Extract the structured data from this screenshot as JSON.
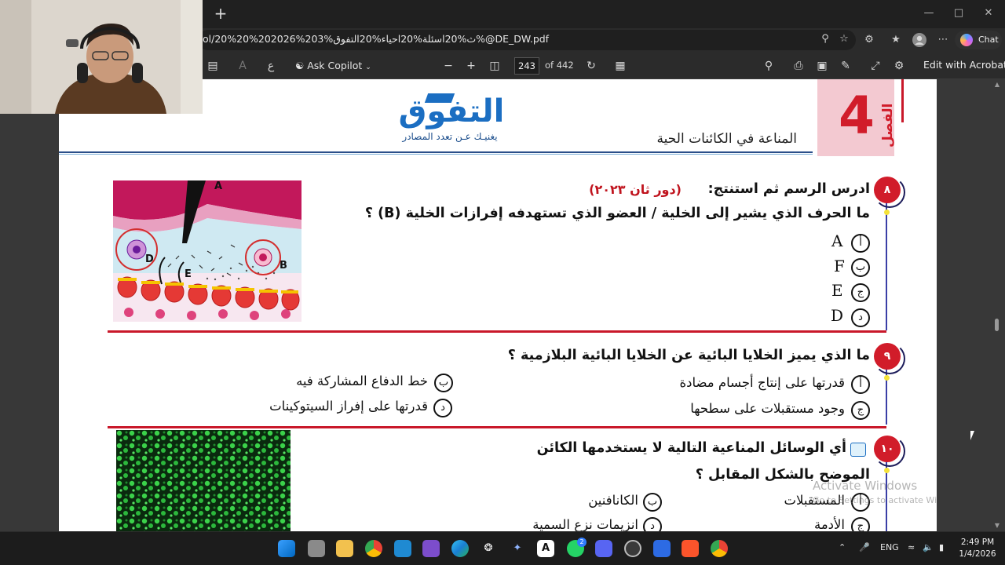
{
  "browser": {
    "url": "ol/20%20%202026%203%ث%20اسئلة%20احياء%20التفوق%@DE_DW.pdf"
  },
  "copilot_chat": {
    "label": "Chat"
  },
  "pdf_toolbar": {
    "ask_copilot": "Ask Copilot",
    "current_page": "243",
    "page_total": "of 442",
    "edit_acrobat": "Edit with Acrobat"
  },
  "page_header": {
    "chapter_label": "الفصل",
    "chapter_number": "4",
    "logo_title": "التفوق",
    "logo_tagline": "يغنيـك عـن تعدد المصادر",
    "subject": "المناعة في الكائنات الحية"
  },
  "questions": [
    {
      "number": "٨",
      "intro": "ادرس الرسم ثم استنتج:",
      "note": "(دور ثان ٢٠٢٣)",
      "text": "ما الحرف الذي يشير إلى الخلية / العضو الذي تستهدفه إفرازات الخلية (B) ؟",
      "options": [
        {
          "letter": "أ",
          "value": "A"
        },
        {
          "letter": "ب",
          "value": "F"
        },
        {
          "letter": "ج",
          "value": "E"
        },
        {
          "letter": "د",
          "value": "D"
        }
      ],
      "figure_labels": [
        "A",
        "B",
        "D",
        "E"
      ]
    },
    {
      "number": "٩",
      "text": "ما الذي يميز الخلايا البائية عن الخلايا البائية البلازمية ؟",
      "options": [
        {
          "letter": "أ",
          "value": "قدرتها على إنتاج أجسام مضادة"
        },
        {
          "letter": "ب",
          "value": "خط الدفاع المشاركة فيه"
        },
        {
          "letter": "ج",
          "value": "وجود مستقبلات على سطحها"
        },
        {
          "letter": "د",
          "value": "قدرتها على إفراز السيتوكينات"
        }
      ]
    },
    {
      "number": "١٠",
      "text": "أي الوسائل المناعية التالية لا يستخدمها الكائن",
      "text2": "الموضح بالشكل المقابل ؟",
      "options": [
        {
          "letter": "أ",
          "value": "المستقبلات"
        },
        {
          "letter": "ب",
          "value": "الكانافنين"
        },
        {
          "letter": "ج",
          "value": "الأدمة"
        },
        {
          "letter": "د",
          "value": "انزيمات نزع السمية"
        }
      ]
    }
  ],
  "watermark": {
    "line1": "Activate Windows",
    "line2": "Go to Settings to activate Windows."
  },
  "taskbar": {
    "language": "ENG",
    "time": "2:49 PM",
    "date": "1/4/2026",
    "whatsapp_badge": "2"
  },
  "colors": {
    "accent_red": "#d11c2a",
    "logo_blue": "#1b6ec2",
    "rule_blue": "#3a3fa6"
  },
  "icons": [
    "add-tab-icon",
    "zoom-icon",
    "favorite-icon",
    "extensions-icon",
    "collections-icon",
    "profile-icon",
    "more-icon",
    "sidebar-toggle-icon",
    "read-aloud-icon",
    "translate-icon",
    "copilot-icon",
    "zoom-out-icon",
    "zoom-in-icon",
    "fit-page-icon",
    "rotate-icon",
    "page-view-icon",
    "search-icon",
    "print-icon",
    "save-icon",
    "save-as-icon",
    "fullscreen-icon",
    "settings-icon"
  ]
}
